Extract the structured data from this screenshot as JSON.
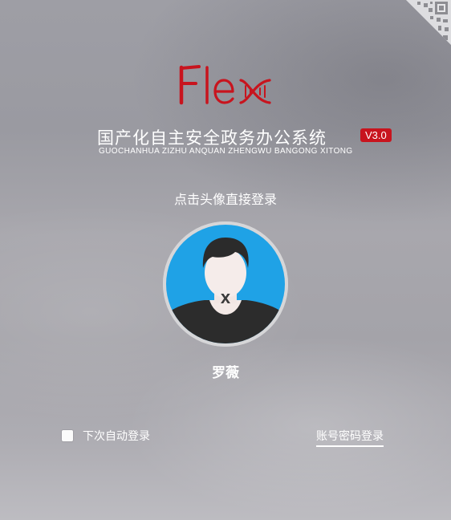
{
  "logo": {
    "text": "Flex"
  },
  "system": {
    "title": "国产化自主安全政务办公系统",
    "version": "V3.0",
    "subtitle": "GUOCHANHUA ZIZHU ANQUAN ZHENGWU BANGONG XITONG"
  },
  "login": {
    "hint": "点击头像直接登录",
    "username": "罗薇",
    "avatar_mark": "x",
    "auto_login_label": "下次自动登录",
    "auto_login_checked": false,
    "password_login_label": "账号密码登录"
  },
  "colors": {
    "brand_red": "#c8141e",
    "avatar_blue": "#1fa2e6",
    "text_white": "#ffffff"
  },
  "icons": {
    "corner": "qr-code-icon",
    "avatar": "user-silhouette-icon"
  }
}
